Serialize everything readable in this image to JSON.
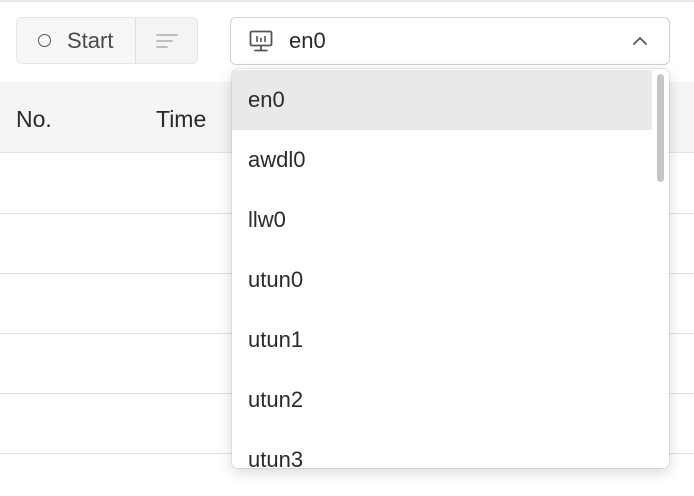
{
  "toolbar": {
    "start_label": "Start",
    "start_icon": "circle-icon",
    "filter_icon": "filter-lines-icon"
  },
  "interface_select": {
    "icon": "monitor-icon",
    "selected": "en0",
    "chevron_icon": "chevron-up-icon",
    "options": [
      "en0",
      "awdl0",
      "llw0",
      "utun0",
      "utun1",
      "utun2",
      "utun3"
    ]
  },
  "table": {
    "columns": [
      "No.",
      "Time"
    ]
  },
  "colors": {
    "selected_option_bg": "#e9e9e9",
    "header_bg": "#f5f5f5",
    "border": "#e2e2e2"
  }
}
